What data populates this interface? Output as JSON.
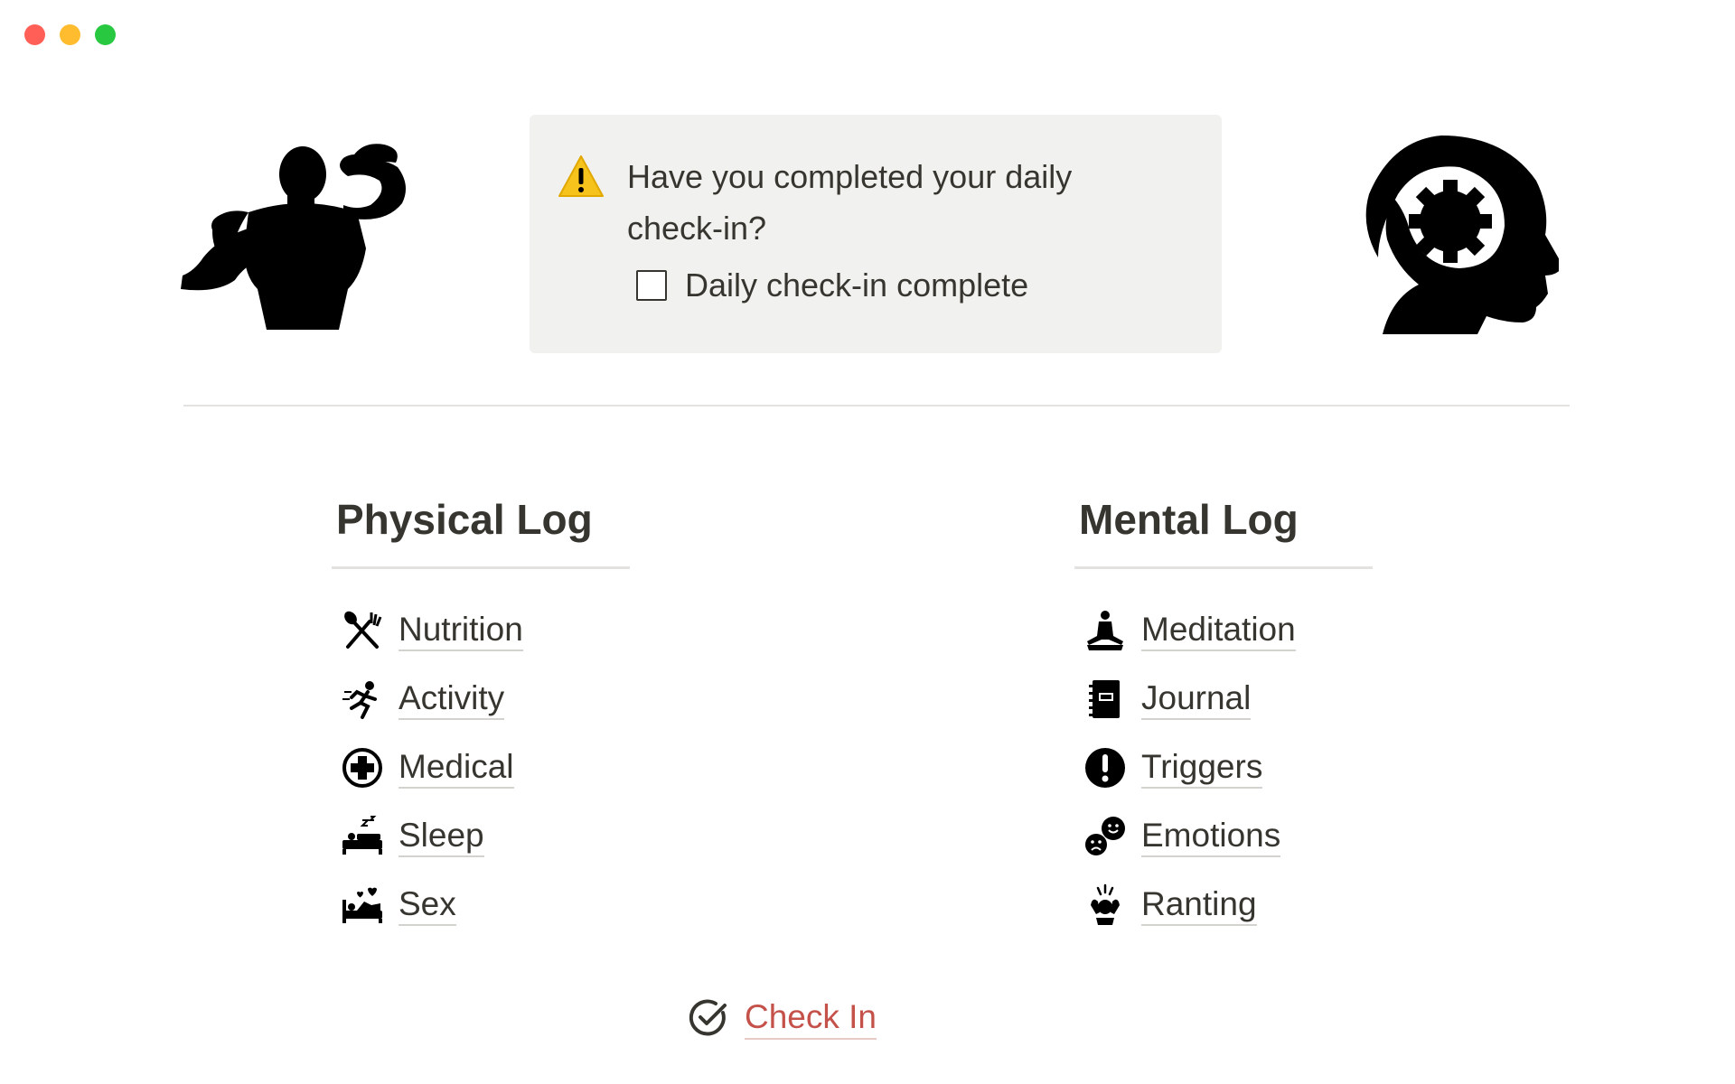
{
  "window": {
    "controls": [
      "close",
      "minimize",
      "maximize"
    ],
    "colors": {
      "close": "#ff5f57",
      "minimize": "#febc2e",
      "maximize": "#28c840"
    }
  },
  "hero": {
    "left_icon": "flexing-bodybuilder-icon",
    "right_icon": "head-with-gear-icon"
  },
  "callout": {
    "emoji": "warning-icon",
    "text": "Have you completed your daily check-in?",
    "todo_label": "Daily check-in complete",
    "todo_checked": false,
    "background": "#f1f1ef"
  },
  "physical": {
    "heading": "Physical Log",
    "items": [
      {
        "label": "Nutrition",
        "icon": "fork-knife-icon"
      },
      {
        "label": "Activity",
        "icon": "running-person-icon"
      },
      {
        "label": "Medical",
        "icon": "medical-cross-icon"
      },
      {
        "label": "Sleep",
        "icon": "sleeping-bed-icon"
      },
      {
        "label": "Sex",
        "icon": "bed-hearts-icon"
      }
    ]
  },
  "mental": {
    "heading": "Mental Log",
    "items": [
      {
        "label": "Meditation",
        "icon": "meditation-icon"
      },
      {
        "label": "Journal",
        "icon": "journal-book-icon"
      },
      {
        "label": "Triggers",
        "icon": "exclamation-circle-icon"
      },
      {
        "label": "Emotions",
        "icon": "emotion-faces-icon"
      },
      {
        "label": "Ranting",
        "icon": "angry-ranting-icon"
      }
    ]
  },
  "checkin": {
    "label": "Check In",
    "icon": "check-circle-icon",
    "color": "#c4524a"
  }
}
